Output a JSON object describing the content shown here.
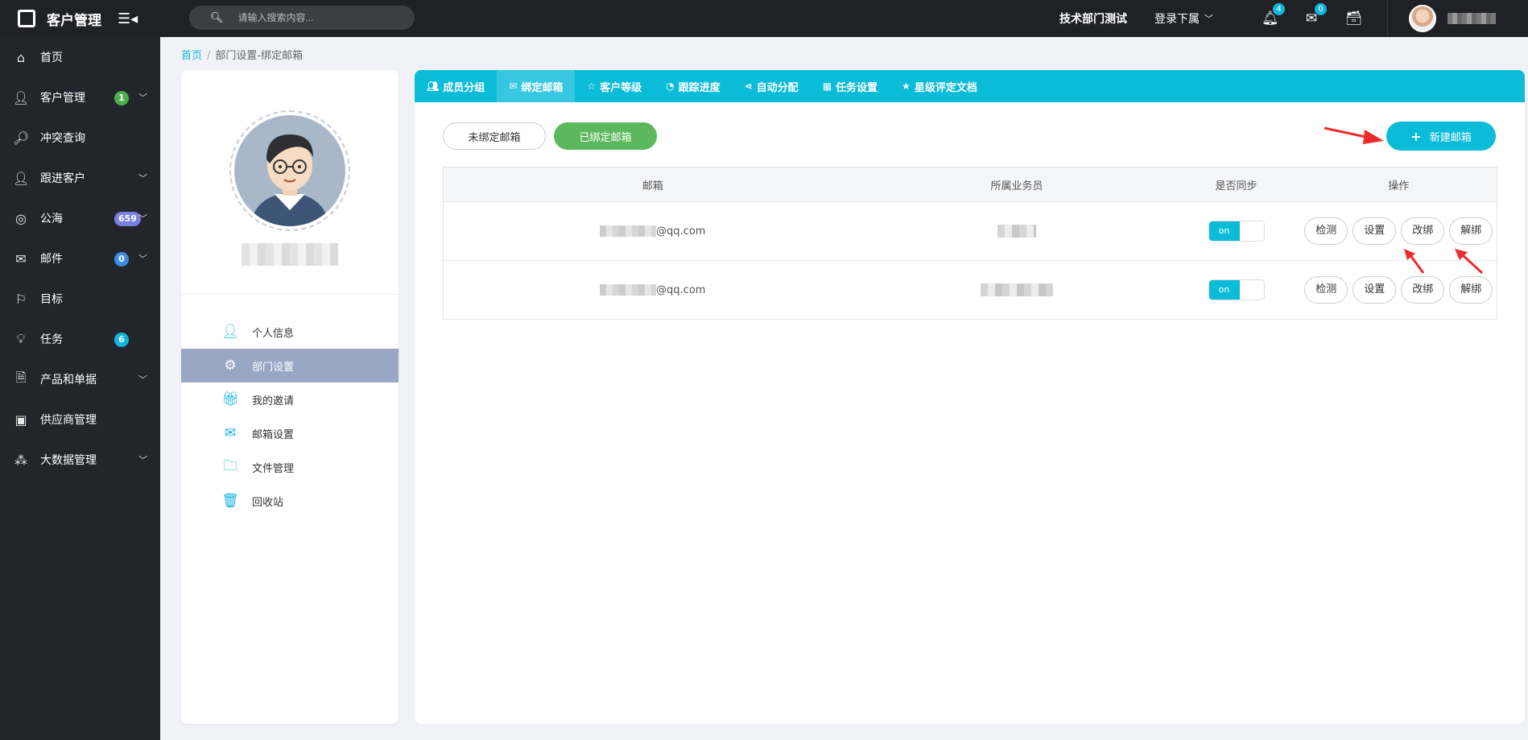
{
  "app": {
    "title": "客户管理"
  },
  "search": {
    "placeholder": "请输入搜索内容..."
  },
  "topbar": {
    "department": "技术部门测试",
    "sub_login": "登录下属",
    "notifications_count": "4",
    "messages_count": "0"
  },
  "sidebar": {
    "items": [
      {
        "label": "首页",
        "icon": "home-icon"
      },
      {
        "label": "客户管理",
        "icon": "user-icon",
        "badge": "1",
        "badge_color": "#4cae4c"
      },
      {
        "label": "冲突查询",
        "icon": "search-doc-icon"
      },
      {
        "label": "跟进客户",
        "icon": "user-icon"
      },
      {
        "label": "公海",
        "icon": "globe-icon",
        "badge": "659",
        "badge_color": "#7a7fe0"
      },
      {
        "label": "邮件",
        "icon": "mail-icon",
        "badge": "0",
        "badge_color": "#3c8cdf"
      },
      {
        "label": "目标",
        "icon": "flag-icon"
      },
      {
        "label": "任务",
        "icon": "bulb-icon",
        "badge": "6",
        "badge_color": "#12b6dc"
      },
      {
        "label": "产品和单据",
        "icon": "doc-icon"
      },
      {
        "label": "供应商管理",
        "icon": "supplier-icon"
      },
      {
        "label": "大数据管理",
        "icon": "network-icon"
      }
    ]
  },
  "breadcrumb": {
    "home": "首页",
    "sep": "/",
    "current": "部门设置-绑定邮箱"
  },
  "profile_menu": [
    {
      "label": "个人信息",
      "icon": "person-icon"
    },
    {
      "label": "部门设置",
      "icon": "gear-icon",
      "active": true
    },
    {
      "label": "我的邀请",
      "icon": "gift-icon"
    },
    {
      "label": "邮箱设置",
      "icon": "envelope-icon"
    },
    {
      "label": "文件管理",
      "icon": "folder-icon"
    },
    {
      "label": "回收站",
      "icon": "trash-icon"
    }
  ],
  "tabs": [
    {
      "label": "成员分组",
      "icon": "group-icon"
    },
    {
      "label": "绑定邮箱",
      "icon": "envelope-icon",
      "active": true
    },
    {
      "label": "客户等级",
      "icon": "star-half-icon"
    },
    {
      "label": "跟踪进度",
      "icon": "pie-icon"
    },
    {
      "label": "自动分配",
      "icon": "share-icon"
    },
    {
      "label": "任务设置",
      "icon": "calendar-icon"
    },
    {
      "label": "星级评定文档",
      "icon": "star-icon"
    }
  ],
  "filters": {
    "unbound": "未绑定邮箱",
    "bound": "已绑定邮箱"
  },
  "new_button": {
    "plus": "+",
    "label": "新建邮箱"
  },
  "table": {
    "headers": [
      "邮箱",
      "所属业务员",
      "是否同步",
      "操作"
    ],
    "rows": [
      {
        "email_suffix": "@qq.com",
        "sync": "on",
        "actions": [
          "检测",
          "设置",
          "改绑",
          "解绑"
        ]
      },
      {
        "email_suffix": "@qq.com",
        "sync": "on",
        "actions": [
          "检测",
          "设置",
          "改绑",
          "解绑"
        ]
      }
    ]
  }
}
